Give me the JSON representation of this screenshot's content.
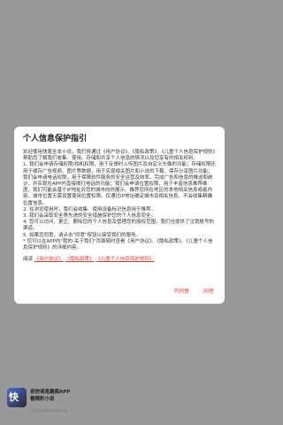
{
  "dialog": {
    "title": "个人信息保护指引",
    "paragraphs": [
      "欢迎使用快笔全本小说，我们将通过《用户协议》、《隐私政策》、《儿童个人信息保护规则》帮助您了解我们收集、使用、存储和共享个人信息的情况以及您享有的相关权利。",
      "1. 我们会申请存储权限/相机权限，用于反馈时上传图片及自定义头像的功能；存储权限还用于缓存广告视频、图片等数据，用于实现相关图片和小说的下载，保存分享图片功能；我们会申请电话权限，用于保障软件服务的安全运营及效率，完成广告和信息的推送和统计，并实现在APP内直接拨打电话的功能；我们会申请位置权限，用于丰富信息推荐维度，我们可能会基于IP地址对您的城市向你展示、推荐您所在地区的本地相关信息或者内容，城市位置无需设置使用位置权限，仅通过IP地址确定城市及相关信息，不会收集精确位置信息。",
      "2. 在浏览使用时，我们会收集、使用设备标识信息用于推荐。",
      "3. 我们会采取安全界先进的安全措施保护您的个人信息安全。",
      "4. 您可以访问、更正、删除您的个人信息及管理您的授权范围，我们也提供了注销账号的渠道。",
      "5. 如果您同意，请点击\"同意\"按钮以接受我们的服务。",
      "* 您可以在APP内\"我的-关于我们\"页面随时查看《用户协议》、《隐私政策》、《儿童个人信息保护规则》的详细内容。"
    ],
    "read_prefix": "阅读",
    "links": [
      "《用户协议》",
      "《隐私政策》",
      "《儿童个人信息保护规则》"
    ],
    "disagree_label": "不同意",
    "agree_label": "同意"
  },
  "brand": {
    "logo_text": "快",
    "name": "来快读笔趣阁APP",
    "slogan": "看精彩小说",
    "copyright": "北京文汉德视文化旗下产品"
  },
  "colors": {
    "overlay": "#999999",
    "accent": "#e53935",
    "dialog_bg": "#ffffff"
  }
}
